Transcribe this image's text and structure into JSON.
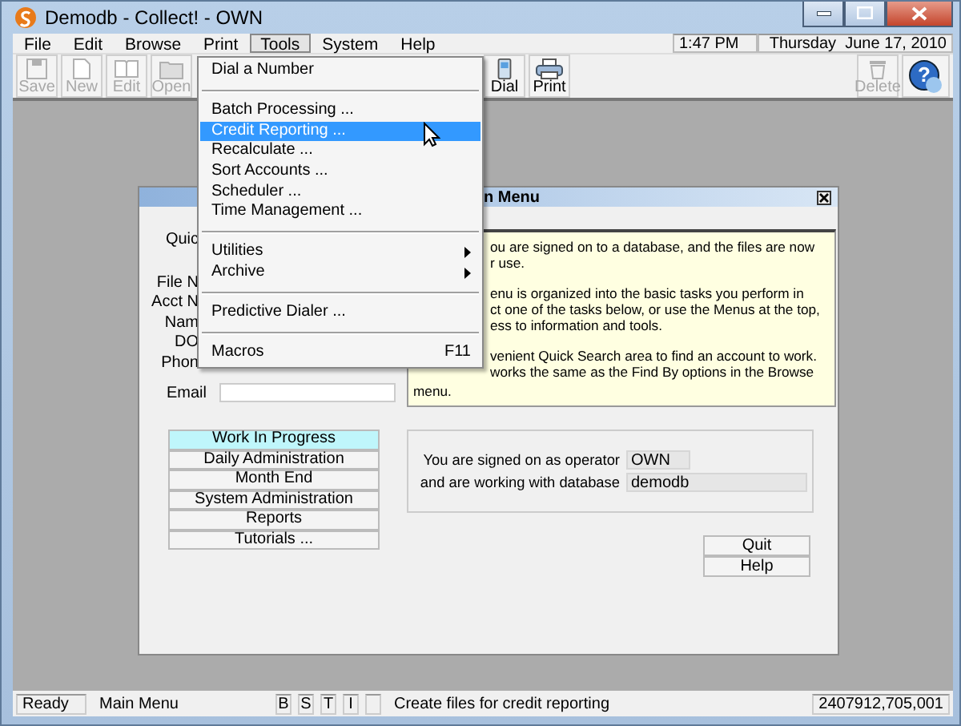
{
  "window": {
    "title": "Demodb - Collect! - OWN"
  },
  "menu_bar": {
    "items": [
      {
        "label": "File",
        "selected": false
      },
      {
        "label": "Edit",
        "selected": false
      },
      {
        "label": "Browse",
        "selected": false
      },
      {
        "label": "Print",
        "selected": false
      },
      {
        "label": "Tools",
        "selected": true
      },
      {
        "label": "System",
        "selected": false
      },
      {
        "label": "Help",
        "selected": false
      }
    ],
    "time": "1:47 PM",
    "date": "Thursday  June 17, 2010"
  },
  "toolbar": {
    "left": [
      {
        "kind": "save",
        "label": "Save",
        "disabled": true
      },
      {
        "kind": "new",
        "label": "New",
        "disabled": true
      },
      {
        "kind": "edit",
        "label": "Edit",
        "disabled": true
      },
      {
        "kind": "open",
        "label": "Open",
        "disabled": true
      }
    ],
    "middle": [
      {
        "kind": "dial",
        "label": "Dial",
        "disabled": false
      },
      {
        "kind": "print",
        "label": "Print",
        "disabled": false
      }
    ],
    "right": [
      {
        "kind": "delete",
        "label": "Delete",
        "disabled": true
      },
      {
        "kind": "help",
        "glyph": "?",
        "disabled": false
      }
    ]
  },
  "tools_menu": {
    "items": [
      {
        "kind": "item",
        "label": "Dial a Number",
        "selected": false,
        "submenu": false
      },
      {
        "kind": "separator"
      },
      {
        "kind": "item",
        "label": "Batch Processing ...",
        "selected": false,
        "submenu": false
      },
      {
        "kind": "item",
        "label": "Credit Reporting ...",
        "selected": true,
        "submenu": false
      },
      {
        "kind": "item",
        "label": "Recalculate ...",
        "selected": false,
        "submenu": false
      },
      {
        "kind": "item",
        "label": "Sort Accounts ...",
        "selected": false,
        "submenu": false
      },
      {
        "kind": "item",
        "label": "Scheduler ...",
        "selected": false,
        "submenu": false
      },
      {
        "kind": "item",
        "label": "Time Management ...",
        "selected": false,
        "submenu": false
      },
      {
        "kind": "separator"
      },
      {
        "kind": "item",
        "label": "Utilities",
        "selected": false,
        "submenu": true
      },
      {
        "kind": "item",
        "label": "Archive",
        "selected": false,
        "submenu": true
      },
      {
        "kind": "separator"
      },
      {
        "kind": "item",
        "label": "Predictive Dialer ...",
        "selected": false,
        "submenu": false
      },
      {
        "kind": "separator"
      },
      {
        "kind": "item",
        "label": "Macros",
        "selected": false,
        "submenu": false,
        "shortcut": "F11"
      }
    ]
  },
  "dialog": {
    "title": "n Menu",
    "quick_label": "Quic",
    "form_labels": [
      "File N",
      "Acct N",
      "Nam",
      "DO",
      "Phon"
    ],
    "email_label": "Email",
    "info": {
      "paragraphs": [
        [
          "ou are signed on to a database, and the files are now",
          "r use."
        ],
        [
          "enu is organized into the basic tasks you perform in",
          "ct one of the tasks below, or use the Menus at the top,",
          "ess to information and tools."
        ],
        [
          "venient Quick Search area to find an account to work.",
          "works the same as the Find By options in the Browse"
        ]
      ],
      "tail": "menu."
    },
    "nav_buttons": [
      {
        "label": "Work In Progress",
        "selected": true
      },
      {
        "label": "Daily Administration",
        "selected": false
      },
      {
        "label": "Month End",
        "selected": false
      },
      {
        "label": "System Administration",
        "selected": false
      },
      {
        "label": "Reports",
        "selected": false
      },
      {
        "label": "Tutorials ...",
        "selected": false
      }
    ],
    "operator": {
      "operator_label": "You are signed on as operator",
      "operator": "OWN",
      "database_label": "and are working with database",
      "database": "demodb"
    },
    "buttons": [
      "Quit",
      "Help"
    ]
  },
  "status_bar": {
    "state": "Ready",
    "view": "Main Menu",
    "flags": [
      "B",
      "S",
      "T",
      "I"
    ],
    "message": "Create files for credit reporting",
    "number": "2407912,705,001"
  }
}
